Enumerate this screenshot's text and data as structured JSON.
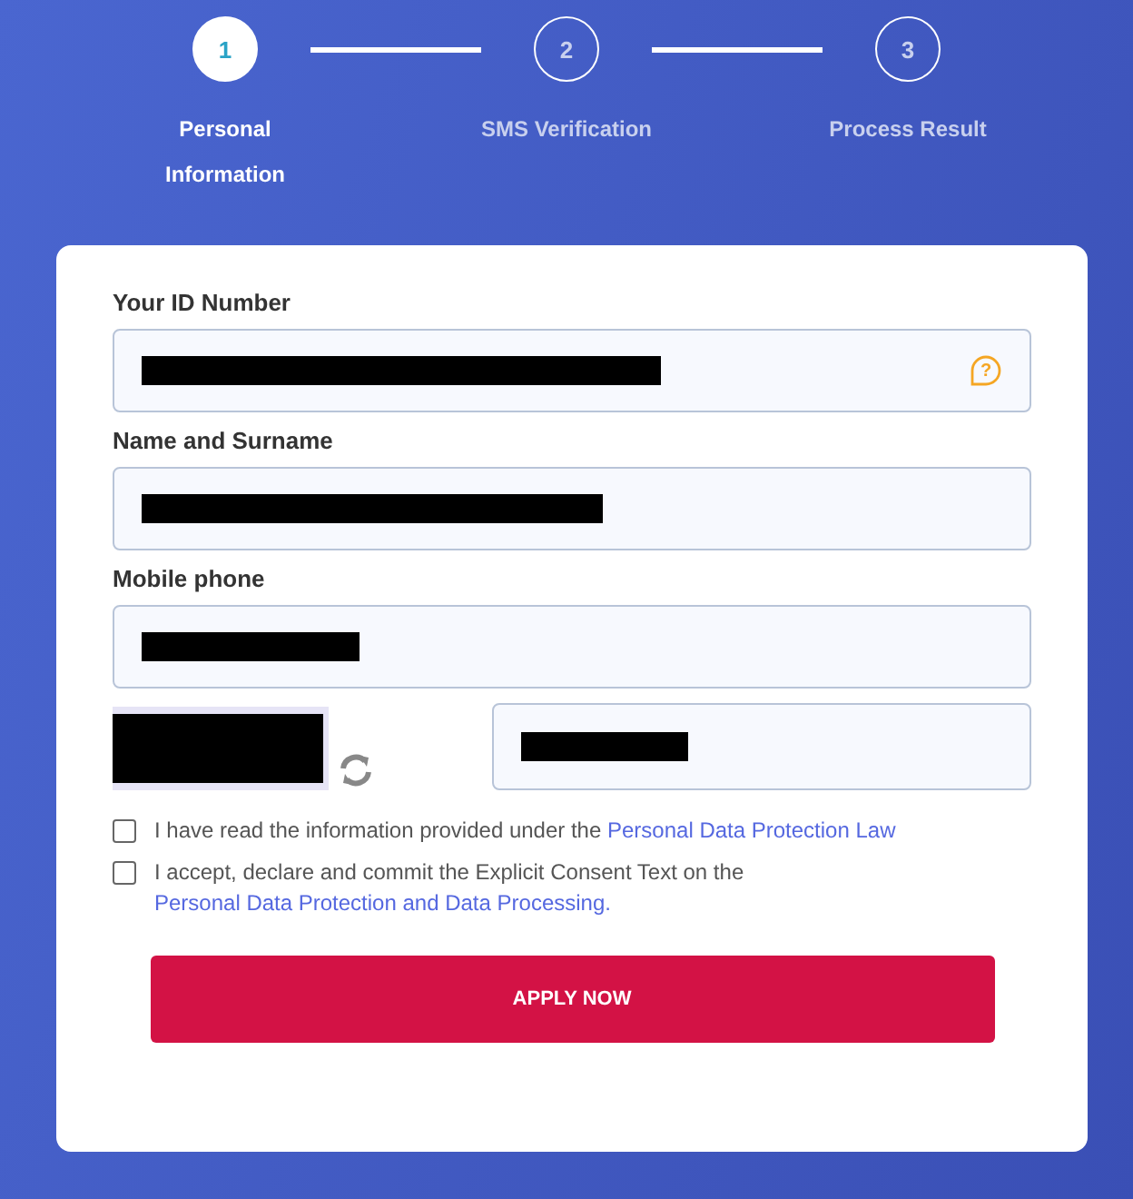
{
  "steps": [
    {
      "number": "1",
      "label": "Personal Information",
      "selected": true
    },
    {
      "number": "2",
      "label": "SMS Verification",
      "selected": false
    },
    {
      "number": "3",
      "label": "Process Result",
      "selected": false
    }
  ],
  "form": {
    "fields": [
      {
        "label": "Your ID Number",
        "redacted": true,
        "help": "?"
      },
      {
        "label": "Name and Surname",
        "redacted": true
      },
      {
        "label": "Mobile phone",
        "redacted": true
      }
    ],
    "captcha": {
      "redacted": true,
      "answer_redacted": true
    },
    "consents": [
      {
        "text": "I have read the information provided under the ",
        "link": "Personal Data Protection Law",
        "checked": false
      },
      {
        "text": "I accept, declare and commit the Explicit Consent Text on the ",
        "link": "Personal Data Protection and Data Processing.",
        "checked": false
      }
    ],
    "submit": "APPLY NOW"
  }
}
